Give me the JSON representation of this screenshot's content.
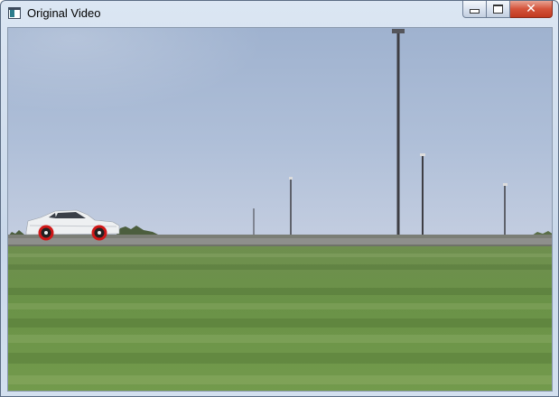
{
  "window": {
    "title": "Original Video",
    "icon": "opencv-window-icon"
  },
  "caption_buttons": {
    "minimize_icon": "minimize-icon",
    "maximize_icon": "restore-icon",
    "close_icon": "close-icon",
    "close_glyph": "✕"
  },
  "video_frame": {
    "description_icon": "video-frame",
    "sky_color": "#a9b9d2",
    "grass_color": "#6d9148",
    "road_color": "#8d8d8d",
    "car_color": "#eef0f2",
    "marker_color": "#d01818"
  }
}
